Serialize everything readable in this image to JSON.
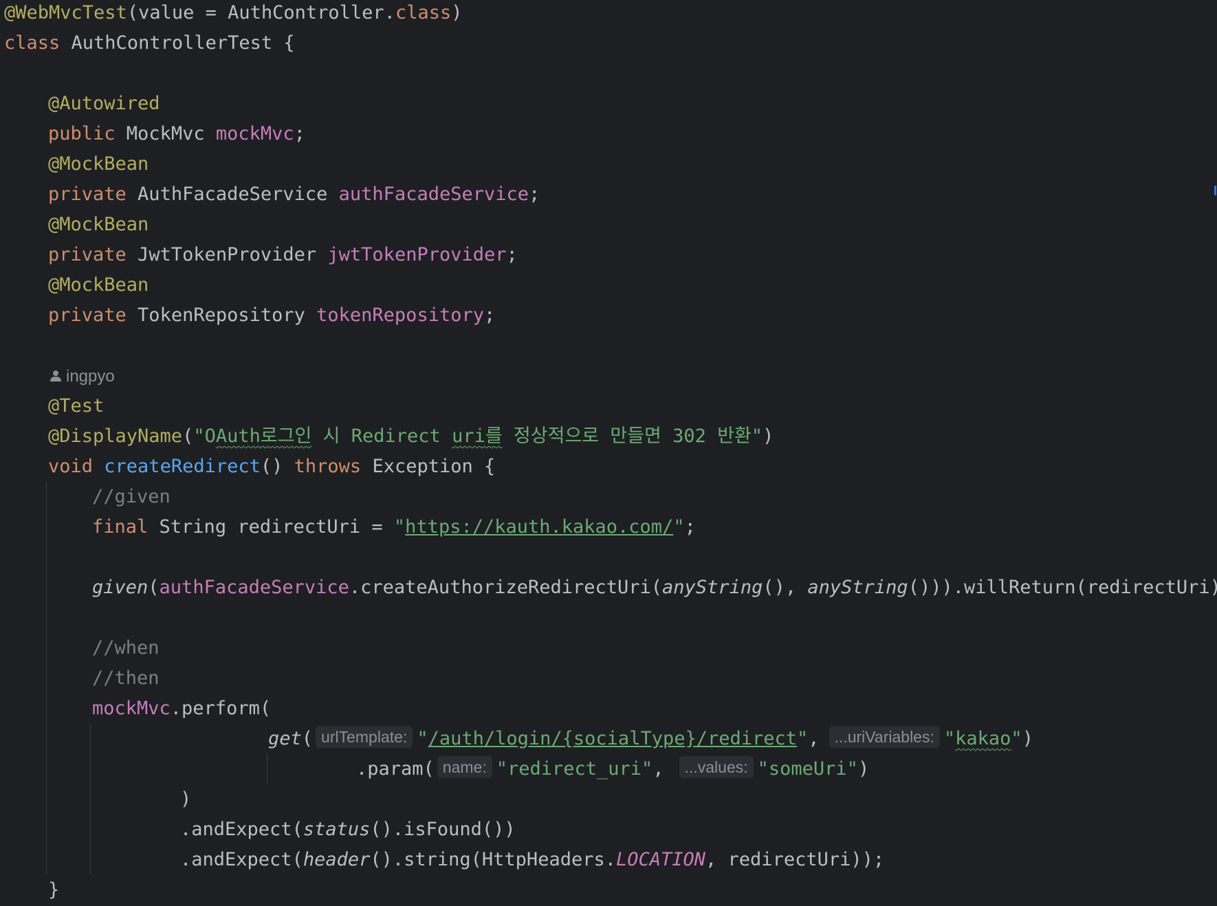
{
  "code": {
    "l1": {
      "ann": "@WebMvcTest",
      "open": "(value = AuthController.",
      "kw": "class",
      "close": ")"
    },
    "l2": {
      "kw": "class",
      "rest": " AuthControllerTest {"
    },
    "l4": {
      "ann": "@Autowired"
    },
    "l5": {
      "kw": "public",
      "type": " MockMvc ",
      "field": "mockMvc",
      "end": ";"
    },
    "l6": {
      "ann": "@MockBean"
    },
    "l7": {
      "kw": "private",
      "type": " AuthFacadeService ",
      "field": "authFacadeService",
      "end": ";"
    },
    "l8": {
      "ann": "@MockBean"
    },
    "l9": {
      "kw": "private",
      "type": " JwtTokenProvider ",
      "field": "jwtTokenProvider",
      "end": ";"
    },
    "l10": {
      "ann": "@MockBean"
    },
    "l11": {
      "kw": "private",
      "type": " TokenRepository ",
      "field": "tokenRepository",
      "end": ";"
    },
    "author": "ingpyo",
    "l13": {
      "ann": "@Test"
    },
    "l14": {
      "ann": "@DisplayName",
      "open": "(",
      "s1": "\"O",
      "s2": "Auth로그인",
      "s3": " 시 Redirect ",
      "s4": "uri를",
      "s5": " 정상적으로 만들면 302 반환\"",
      "close": ")"
    },
    "l15": {
      "kw1": "void",
      "method": " createRedirect",
      "mid": "() ",
      "kw2": "throws",
      "rest": " Exception {"
    },
    "l16": {
      "comment": "//given"
    },
    "l17": {
      "kw": "final",
      "mid": " String redirectUri = ",
      "q1": "\"",
      "url": "https://kauth.kakao.com/",
      "q2": "\"",
      "end": ";"
    },
    "l19": {
      "given": "given",
      "p1": "(",
      "field": "authFacadeService",
      "p2": ".createAuthorizeRedirectUri(",
      "any1": "anyString",
      "p3": "(), ",
      "any2": "anyString",
      "p4": "())).willReturn(redirectUri);"
    },
    "l21": {
      "comment": "//when"
    },
    "l22": {
      "comment": "//then"
    },
    "l23": {
      "field": "mockMvc",
      "rest": ".perform("
    },
    "l24": {
      "get": "get",
      "p1": "(",
      "hint1": "urlTemplate:",
      "q1": "\"",
      "path": "/auth/login/{socialType}/redirect",
      "q2": "\"",
      "comma": ",",
      "hint2": "...uriVariables:",
      "q3": "\"",
      "val": "kakao",
      "q4": "\"",
      "close": ")"
    },
    "l25": {
      "p1": ".param(",
      "hint1": "name:",
      "s1": "\"redirect_uri\"",
      "comma": ",",
      "hint2": "...values:",
      "s2": "\"someUri\"",
      "close": ")"
    },
    "l26": {
      "close": ")"
    },
    "l27": {
      "p1": ".andExpect(",
      "status": "status",
      "rest": "().isFound())"
    },
    "l28": {
      "p1": ".andExpect(",
      "header": "header",
      "p2": "().string(HttpHeaders.",
      "loc": "LOCATION",
      "rest": ", redirectUri));"
    },
    "l29": {
      "close": "}"
    }
  }
}
